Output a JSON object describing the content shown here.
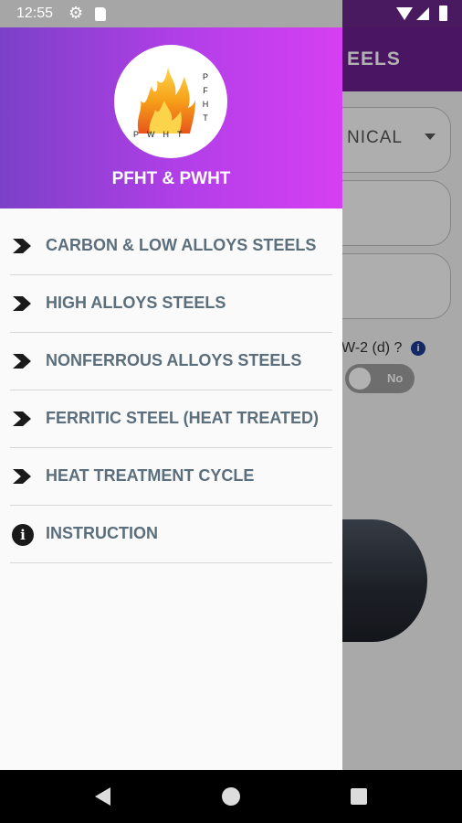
{
  "status_bar": {
    "time": "12:55"
  },
  "background_app": {
    "title": "EELS",
    "select_value": "NICAL",
    "question": "W-2 (d) ?",
    "toggle_label": "No"
  },
  "drawer": {
    "logo": {
      "side_letters": "PFHT",
      "bottom_letters": "PWHT"
    },
    "title": "PFHT & PWHT",
    "menu": [
      {
        "label": "CARBON & LOW ALLOYS STEELS",
        "icon": "chevron-right-icon"
      },
      {
        "label": "HIGH ALLOYS STEELS",
        "icon": "chevron-right-icon"
      },
      {
        "label": "NONFERROUS ALLOYS STEELS",
        "icon": "chevron-right-icon"
      },
      {
        "label": "FERRITIC STEEL (HEAT TREATED)",
        "icon": "chevron-right-icon"
      },
      {
        "label": "HEAT TREATMENT CYCLE",
        "icon": "chevron-right-icon"
      },
      {
        "label": "INSTRUCTION",
        "icon": "info-icon"
      }
    ]
  },
  "colors": {
    "header_gradient_start": "#7c40c8",
    "header_gradient_end": "#d63ff2",
    "menu_text": "#5b6e7c",
    "app_bar": "#6a1f8f"
  }
}
